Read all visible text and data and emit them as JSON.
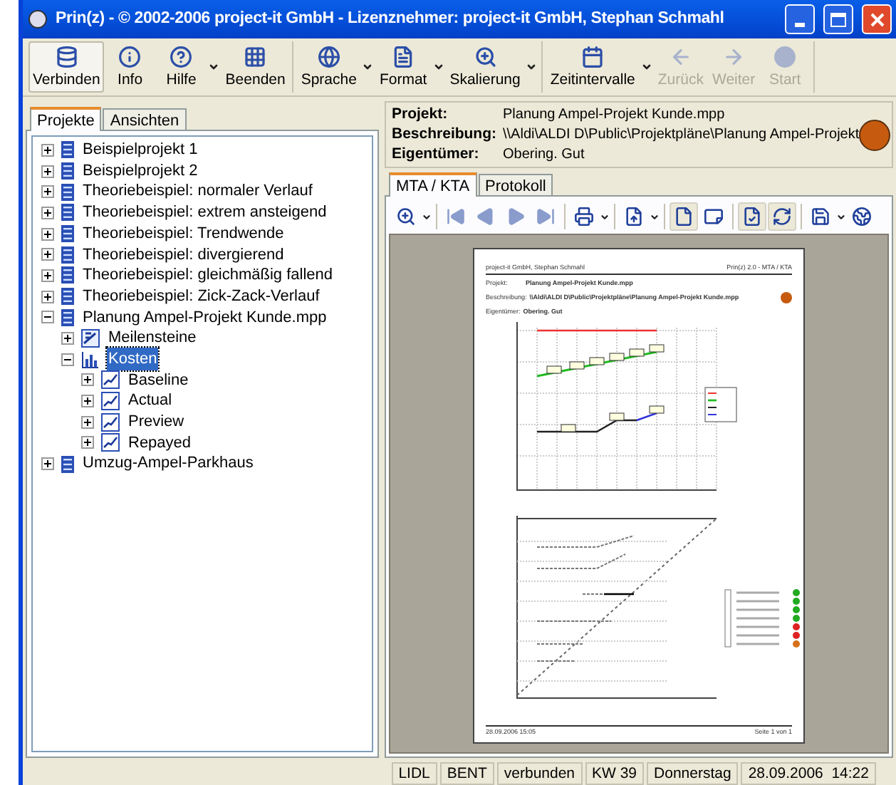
{
  "window": {
    "title": "Prin(z) - © 2002-2006 project-it GmbH - Lizenznehmer: project-it GmbH, Stephan Schmahl"
  },
  "toolbar": [
    [
      {
        "label": "Verbinden",
        "pressed": true,
        "dropdown": false,
        "disabled": false
      },
      {
        "label": "Info",
        "pressed": false,
        "dropdown": false,
        "disabled": false
      },
      {
        "label": "Hilfe",
        "pressed": false,
        "dropdown": true,
        "disabled": false
      },
      {
        "label": "Beenden",
        "pressed": false,
        "dropdown": false,
        "disabled": false
      }
    ],
    [
      {
        "label": "Sprache",
        "pressed": false,
        "dropdown": true,
        "disabled": false
      },
      {
        "label": "Format",
        "pressed": false,
        "dropdown": true,
        "disabled": false
      },
      {
        "label": "Skalierung",
        "pressed": false,
        "dropdown": true,
        "disabled": false
      }
    ],
    [
      {
        "label": "Zeitintervalle",
        "pressed": false,
        "dropdown": true,
        "disabled": false
      },
      {
        "label": "Zurück",
        "pressed": false,
        "dropdown": false,
        "disabled": true
      },
      {
        "label": "Weiter",
        "pressed": false,
        "dropdown": false,
        "disabled": true
      },
      {
        "label": "Start",
        "pressed": false,
        "dropdown": false,
        "disabled": true
      }
    ]
  ],
  "left_tabs": [
    {
      "label": "Projekte",
      "selected": true
    },
    {
      "label": "Ansichten",
      "selected": false
    }
  ],
  "tree": [
    {
      "label": "Beispielprojekt 1",
      "kind": "project",
      "expanded": false,
      "selected": false
    },
    {
      "label": "Beispielprojekt 2",
      "kind": "project",
      "expanded": false,
      "selected": false
    },
    {
      "label": "Theoriebeispiel: normaler Verlauf",
      "kind": "project",
      "expanded": false,
      "selected": false
    },
    {
      "label": "Theoriebeispiel: extrem ansteigend",
      "kind": "project",
      "expanded": false,
      "selected": false
    },
    {
      "label": "Theoriebeispiel: Trendwende",
      "kind": "project",
      "expanded": false,
      "selected": false
    },
    {
      "label": "Theoriebeispiel: divergierend",
      "kind": "project",
      "expanded": false,
      "selected": false
    },
    {
      "label": "Theoriebeispiel: gleichmäßig fallend",
      "kind": "project",
      "expanded": false,
      "selected": false
    },
    {
      "label": "Theoriebeispiel: Zick-Zack-Verlauf",
      "kind": "project",
      "expanded": false,
      "selected": false
    },
    {
      "label": "Planung Ampel-Projekt Kunde.mpp",
      "kind": "project",
      "expanded": true,
      "selected": false,
      "children": [
        {
          "label": "Meilensteine",
          "kind": "milestones",
          "expanded": false,
          "selected": false
        },
        {
          "label": "Kosten",
          "kind": "costs",
          "expanded": true,
          "selected": true,
          "children": [
            {
              "label": "Baseline",
              "kind": "curve",
              "expanded": false,
              "selected": false
            },
            {
              "label": "Actual",
              "kind": "curve",
              "expanded": false,
              "selected": false
            },
            {
              "label": "Preview",
              "kind": "curve",
              "expanded": false,
              "selected": false
            },
            {
              "label": "Repayed",
              "kind": "curve",
              "expanded": false,
              "selected": false
            }
          ]
        }
      ]
    },
    {
      "label": "Umzug-Ampel-Parkhaus",
      "kind": "project",
      "expanded": false,
      "selected": false
    }
  ],
  "info": [
    {
      "label": "Projekt:",
      "value": "Planung Ampel-Projekt Kunde.mpp"
    },
    {
      "label": "Beschreibung:",
      "value": "\\\\Aldi\\ALDI D\\Public\\Projektpläne\\Planung Ampel-Projekt"
    },
    {
      "label": "Eigentümer:",
      "value": "Obering. Gut"
    }
  ],
  "right_tabs": [
    {
      "label": "MTA / KTA",
      "selected": true
    },
    {
      "label": "Protokoll",
      "selected": false
    }
  ],
  "preview_toolbar": [
    {
      "pressed": false,
      "dropdown": true
    },
    {
      "pressed": false,
      "dropdown": false
    },
    {
      "pressed": false,
      "dropdown": false
    },
    {
      "pressed": false,
      "dropdown": false
    },
    {
      "pressed": false,
      "dropdown": false
    },
    {
      "pressed": false,
      "dropdown": true
    },
    {
      "pressed": false,
      "dropdown": true
    },
    {
      "pressed": true,
      "dropdown": false
    },
    {
      "pressed": false,
      "dropdown": false
    },
    {
      "pressed": true,
      "dropdown": false
    },
    {
      "pressed": true,
      "dropdown": false
    },
    {
      "pressed": false,
      "dropdown": true
    },
    {
      "pressed": false,
      "dropdown": false
    }
  ],
  "document": {
    "header_left": "project-it GmbH, Stephan Schmahl",
    "header_right": "Prin(z) 2.0 - MTA / KTA",
    "info": [
      {
        "label": "Projekt:",
        "value": "Planung Ampel-Projekt Kunde.mpp"
      },
      {
        "label": "Beschreibung:",
        "value": "\\\\Aldi\\ALDI D\\Public\\Projektpläne\\Planung Ampel-Projekt Kunde.mpp"
      },
      {
        "label": "Eigentümer:",
        "value": "Obering. Gut"
      }
    ],
    "footer_left": "28.09.2006  15:05",
    "footer_right": "Seite 1 von 1"
  },
  "status_bar": [
    "LIDL",
    "BENT",
    "verbunden",
    "KW 39",
    "Donnerstag",
    "28.09.2006  14:22"
  ]
}
